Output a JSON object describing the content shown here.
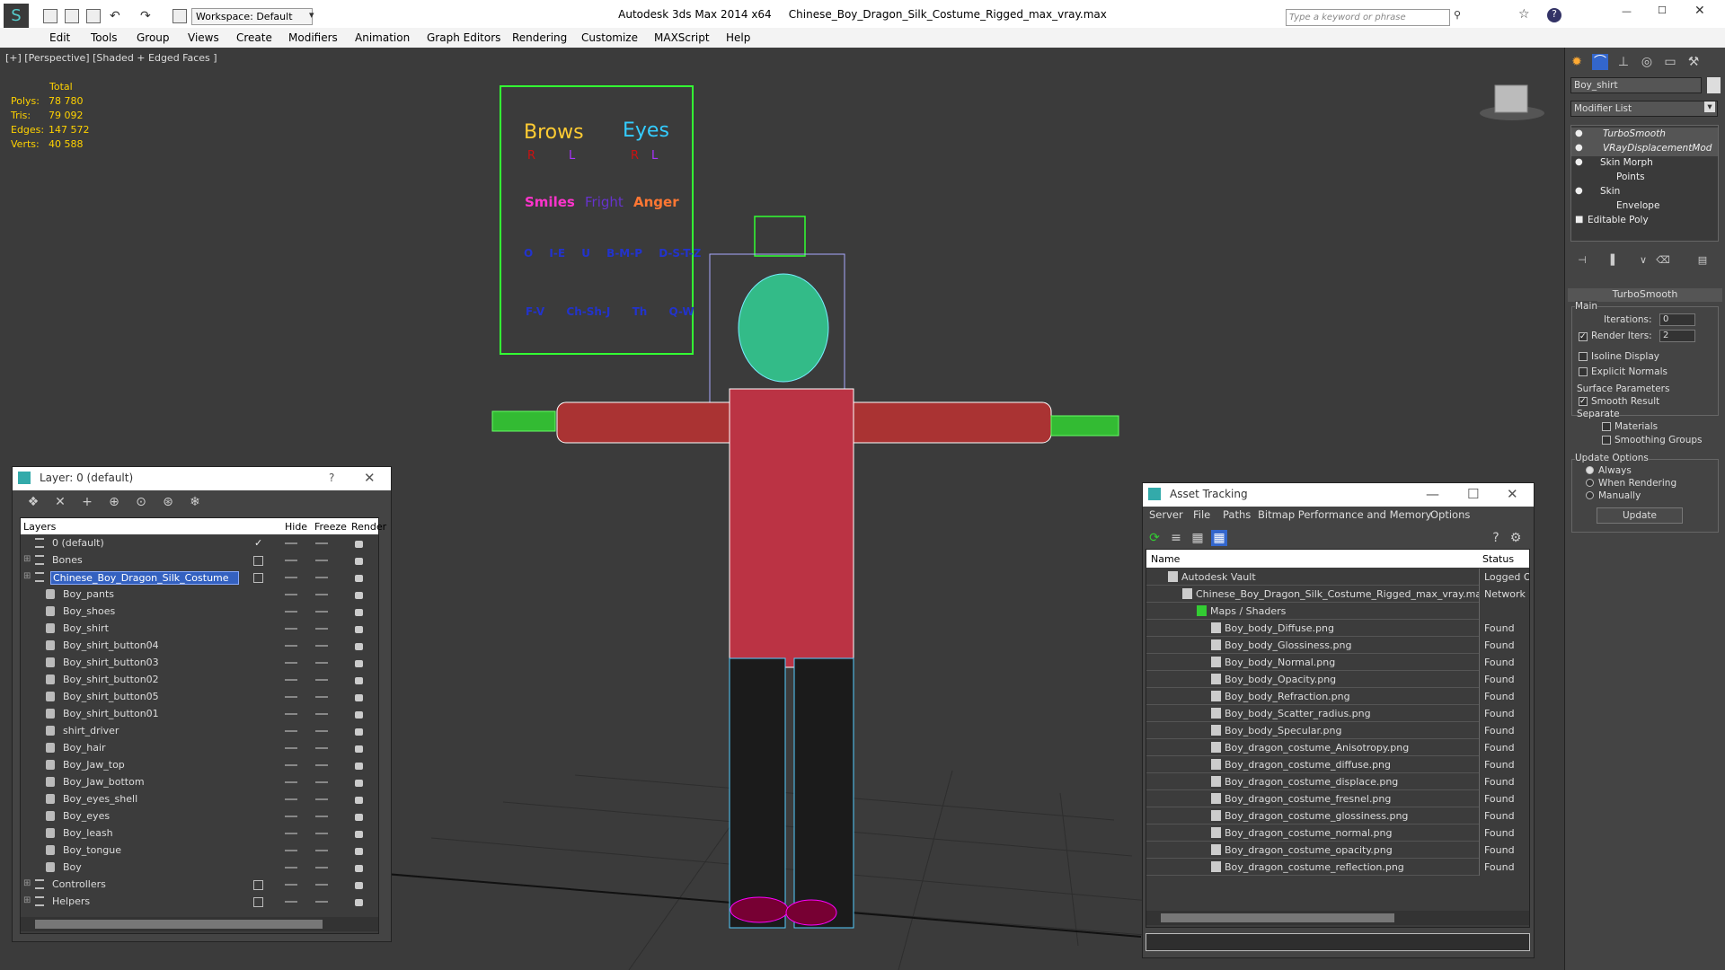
{
  "window": {
    "app_title": "Autodesk 3ds Max  2014 x64",
    "file_title": "Chinese_Boy_Dragon_Silk_Costume_Rigged_max_vray.max",
    "workspace": "Workspace: Default",
    "search_placeholder": "Type a keyword or phrase"
  },
  "menu": [
    "Edit",
    "Tools",
    "Group",
    "Views",
    "Create",
    "Modifiers",
    "Animation",
    "Graph Editors",
    "Rendering",
    "Customize",
    "MAXScript",
    "Help"
  ],
  "viewport": {
    "label": "[+] [Perspective] [Shaded + Edged Faces ]",
    "stats": {
      "header": "Total",
      "rows": [
        {
          "label": "Polys:",
          "value": "78 780"
        },
        {
          "label": "Tris:",
          "value": "79 092"
        },
        {
          "label": "Edges:",
          "value": "147 572"
        },
        {
          "label": "Verts:",
          "value": "40 588"
        }
      ]
    },
    "face_board": {
      "brows": "Brows",
      "eyes": "Eyes",
      "r": "R",
      "l": "L",
      "smiles": "Smiles",
      "fright": "Fright",
      "anger": "Anger",
      "phon1": [
        "O",
        "I-E",
        "U",
        "B-M-P",
        "D-S-T-Z"
      ],
      "phon2": [
        "F-V",
        "Ch-Sh-J",
        "Th",
        "Q-W"
      ]
    }
  },
  "layer_window": {
    "title": "Layer: 0 (default)",
    "help": "?",
    "columns": [
      "Layers",
      "Hide",
      "Freeze",
      "Render"
    ],
    "rows": [
      {
        "name": "0 (default)",
        "level": 0,
        "type": "layer",
        "current": true
      },
      {
        "name": "Bones",
        "level": 0,
        "type": "layer",
        "expandable": true
      },
      {
        "name": "Chinese_Boy_Dragon_Silk_Costume",
        "level": 0,
        "type": "layer",
        "expandable": true,
        "selected": true
      },
      {
        "name": "Boy_pants",
        "level": 1
      },
      {
        "name": "Boy_shoes",
        "level": 1
      },
      {
        "name": "Boy_shirt",
        "level": 1
      },
      {
        "name": "Boy_shirt_button04",
        "level": 1
      },
      {
        "name": "Boy_shirt_button03",
        "level": 1
      },
      {
        "name": "Boy_shirt_button02",
        "level": 1
      },
      {
        "name": "Boy_shirt_button05",
        "level": 1
      },
      {
        "name": "Boy_shirt_button01",
        "level": 1
      },
      {
        "name": "shirt_driver",
        "level": 1
      },
      {
        "name": "Boy_hair",
        "level": 1
      },
      {
        "name": "Boy_Jaw_top",
        "level": 1
      },
      {
        "name": "Boy_Jaw_bottom",
        "level": 1
      },
      {
        "name": "Boy_eyes_shell",
        "level": 1
      },
      {
        "name": "Boy_eyes",
        "level": 1
      },
      {
        "name": "Boy_leash",
        "level": 1
      },
      {
        "name": "Boy_tongue",
        "level": 1
      },
      {
        "name": "Boy",
        "level": 1
      },
      {
        "name": "Controllers",
        "level": 0,
        "type": "layer",
        "expandable": true
      },
      {
        "name": "Helpers",
        "level": 0,
        "type": "layer",
        "expandable": true
      }
    ]
  },
  "asset_window": {
    "title": "Asset Tracking",
    "menu": [
      "Server",
      "File",
      "Paths",
      "Bitmap Performance and Memory",
      "Options"
    ],
    "columns": [
      "Name",
      "Status"
    ],
    "rows": [
      {
        "name": "Autodesk Vault",
        "status": "Logged O",
        "indent": 0
      },
      {
        "name": "Chinese_Boy_Dragon_Silk_Costume_Rigged_max_vray.max",
        "status": "Network F",
        "indent": 1
      },
      {
        "name": "Maps / Shaders",
        "status": "",
        "indent": 2
      },
      {
        "name": "Boy_body_Diffuse.png",
        "status": "Found",
        "indent": 3
      },
      {
        "name": "Boy_body_Glossiness.png",
        "status": "Found",
        "indent": 3
      },
      {
        "name": "Boy_body_Normal.png",
        "status": "Found",
        "indent": 3
      },
      {
        "name": "Boy_body_Opacity.png",
        "status": "Found",
        "indent": 3
      },
      {
        "name": "Boy_body_Refraction.png",
        "status": "Found",
        "indent": 3
      },
      {
        "name": "Boy_body_Scatter_radius.png",
        "status": "Found",
        "indent": 3
      },
      {
        "name": "Boy_body_Specular.png",
        "status": "Found",
        "indent": 3
      },
      {
        "name": "Boy_dragon_costume_Anisotropy.png",
        "status": "Found",
        "indent": 3
      },
      {
        "name": "Boy_dragon_costume_diffuse.png",
        "status": "Found",
        "indent": 3
      },
      {
        "name": "Boy_dragon_costume_displace.png",
        "status": "Found",
        "indent": 3
      },
      {
        "name": "Boy_dragon_costume_fresnel.png",
        "status": "Found",
        "indent": 3
      },
      {
        "name": "Boy_dragon_costume_glossiness.png",
        "status": "Found",
        "indent": 3
      },
      {
        "name": "Boy_dragon_costume_normal.png",
        "status": "Found",
        "indent": 3
      },
      {
        "name": "Boy_dragon_costume_opacity.png",
        "status": "Found",
        "indent": 3
      },
      {
        "name": "Boy_dragon_costume_reflection.png",
        "status": "Found",
        "indent": 3
      }
    ]
  },
  "command_panel": {
    "object_name": "Boy_shirt",
    "modifier_list": "Modifier List",
    "stack": [
      {
        "name": "TurboSmooth",
        "italic": true
      },
      {
        "name": "VRayDisplacementMod",
        "italic": true
      },
      {
        "name": "Skin Morph"
      },
      {
        "name": "Points",
        "sub": true
      },
      {
        "name": "Skin"
      },
      {
        "name": "Envelope",
        "sub": true
      },
      {
        "name": "Editable Poly"
      }
    ],
    "rollout": "TurboSmooth",
    "main": "Main",
    "iterations_label": "Iterations:",
    "iterations": "0",
    "render_iters_label": "Render Iters:",
    "render_iters": "2",
    "isoline": "Isoline Display",
    "explicit": "Explicit Normals",
    "surface": "Surface Parameters",
    "smooth": "Smooth Result",
    "separate": "Separate",
    "materials": "Materials",
    "smoothing": "Smoothing Groups",
    "update_options": "Update Options",
    "always": "Always",
    "when_rendering": "When Rendering",
    "manually": "Manually",
    "update_btn": "Update"
  }
}
